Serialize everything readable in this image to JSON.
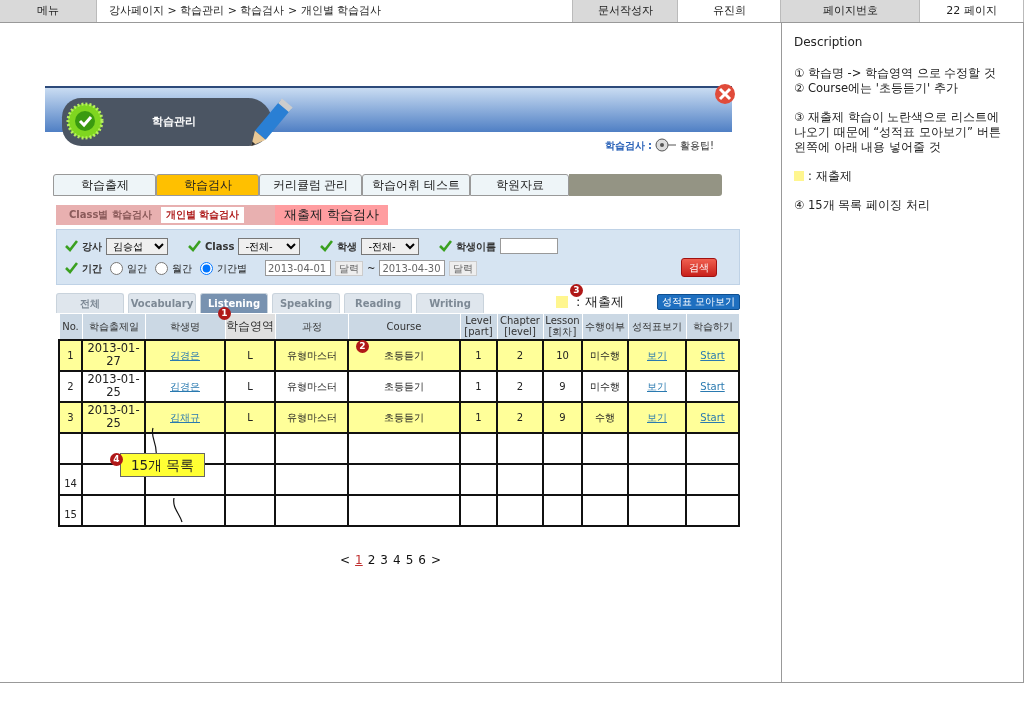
{
  "header": {
    "menu_label": "메뉴",
    "breadcrumb": "강사페이지 > 학습관리 > 학습검사 > 개인별 학습검사",
    "author_label": "문서작성자",
    "author": "유진희",
    "page_label": "페이지번호",
    "page": "22 페이지"
  },
  "banner": {
    "title": "학습관리",
    "help_label": "학습검사 :",
    "help_tip": "활용팁!"
  },
  "main_tabs": [
    {
      "label": "학습출제",
      "selected": false
    },
    {
      "label": "학습검사",
      "selected": true
    },
    {
      "label": "커리큘럼 관리",
      "selected": false
    },
    {
      "label": "학습어휘 테스트",
      "selected": false
    },
    {
      "label": "학원자료",
      "selected": false
    }
  ],
  "sub_tabs": [
    {
      "label": "Class별 학습검사",
      "selected": false
    },
    {
      "label": "개인별 학습검사",
      "selected": true
    }
  ],
  "sub_title": "재출제 학습검사",
  "filters": {
    "teacher": {
      "label": "강사",
      "value": "김승섭"
    },
    "class": {
      "label": "Class",
      "value": "-전체-"
    },
    "student": {
      "label": "학생",
      "value": "-전체-"
    },
    "student_name": {
      "label": "학생이름"
    },
    "period": {
      "label": "기간",
      "options": [
        {
          "label": "일간",
          "selected": false
        },
        {
          "label": "월간",
          "selected": false
        },
        {
          "label": "기간별",
          "selected": true
        }
      ],
      "from": "2013-04-01",
      "to": "2013-04-30",
      "calendar_buttons": [
        "달력",
        "달력"
      ],
      "separator": "~"
    },
    "search_button": "검색"
  },
  "area_tabs": [
    {
      "label": "전체",
      "selected": false
    },
    {
      "label": "Vocabulary",
      "selected": false
    },
    {
      "label": "Listening",
      "selected": true
    },
    {
      "label": "Speaking",
      "selected": false
    },
    {
      "label": "Reading",
      "selected": false
    },
    {
      "label": "Writing",
      "selected": false
    }
  ],
  "legend": {
    "color": "#fff68f",
    "label": ": 재출제"
  },
  "collect_button": "성적표 모아보기",
  "table": {
    "columns": [
      "No.",
      "학습출제일",
      "학생명",
      "학습영역",
      "과정",
      "Course",
      "Level\n[part]",
      "Chapter\n[level]",
      "Lesson\n[회차]",
      "수행여부",
      "성적표보기",
      "학습하기"
    ],
    "rows": [
      {
        "no": "1",
        "date": "2013-01-27",
        "student": "김경은",
        "area": "L",
        "program": "유형마스터",
        "course": "초등듣기",
        "level": "1",
        "chapter": "2",
        "lesson": "10",
        "done": "미수행",
        "report": "보기",
        "study": "Start",
        "repeat": true
      },
      {
        "no": "2",
        "date": "2013-01-25",
        "student": "김경은",
        "area": "L",
        "program": "유형마스터",
        "course": "초등듣기",
        "level": "1",
        "chapter": "2",
        "lesson": "9",
        "done": "미수행",
        "report": "보기",
        "study": "Start",
        "repeat": false
      },
      {
        "no": "3",
        "date": "2013-01-25",
        "student": "김채규",
        "area": "L",
        "program": "유형마스터",
        "course": "초등듣기",
        "level": "1",
        "chapter": "2",
        "lesson": "9",
        "done": "수행",
        "report": "보기",
        "study": "Start",
        "repeat": true
      }
    ],
    "filler_rows": [
      {
        "no": null
      },
      {
        "no": "14"
      },
      {
        "no": "15"
      }
    ]
  },
  "annotations": {
    "markers": [
      "1",
      "2",
      "3",
      "4"
    ],
    "callout": "15개 목록"
  },
  "pagination": {
    "prev": "<",
    "pages": [
      {
        "label": "1",
        "selected": true
      },
      {
        "label": "2",
        "selected": false
      },
      {
        "label": "3",
        "selected": false
      },
      {
        "label": "4",
        "selected": false
      },
      {
        "label": "5",
        "selected": false
      },
      {
        "label": "6",
        "selected": false
      }
    ],
    "next": ">"
  },
  "description": {
    "title": "Description",
    "groups": [
      [
        {
          "kind": "note",
          "text": "①  학습명 -> 학습영역 으로 수정할 것"
        },
        {
          "kind": "note",
          "text": "②  Course에는 '초등듣기' 추가"
        }
      ],
      [
        {
          "kind": "note",
          "text": "③  재출제 학습이 노란색으로 리스트에 나오기 때문에 “성적표 모아보기” 버튼 왼쪽에 아래 내용 넣어줄 것"
        }
      ],
      [
        {
          "kind": "legend",
          "color": "#fff68f",
          "text": ": 재출제"
        }
      ],
      [
        {
          "kind": "note",
          "text": "④ 15개 목록 페이징 처리"
        }
      ]
    ]
  }
}
